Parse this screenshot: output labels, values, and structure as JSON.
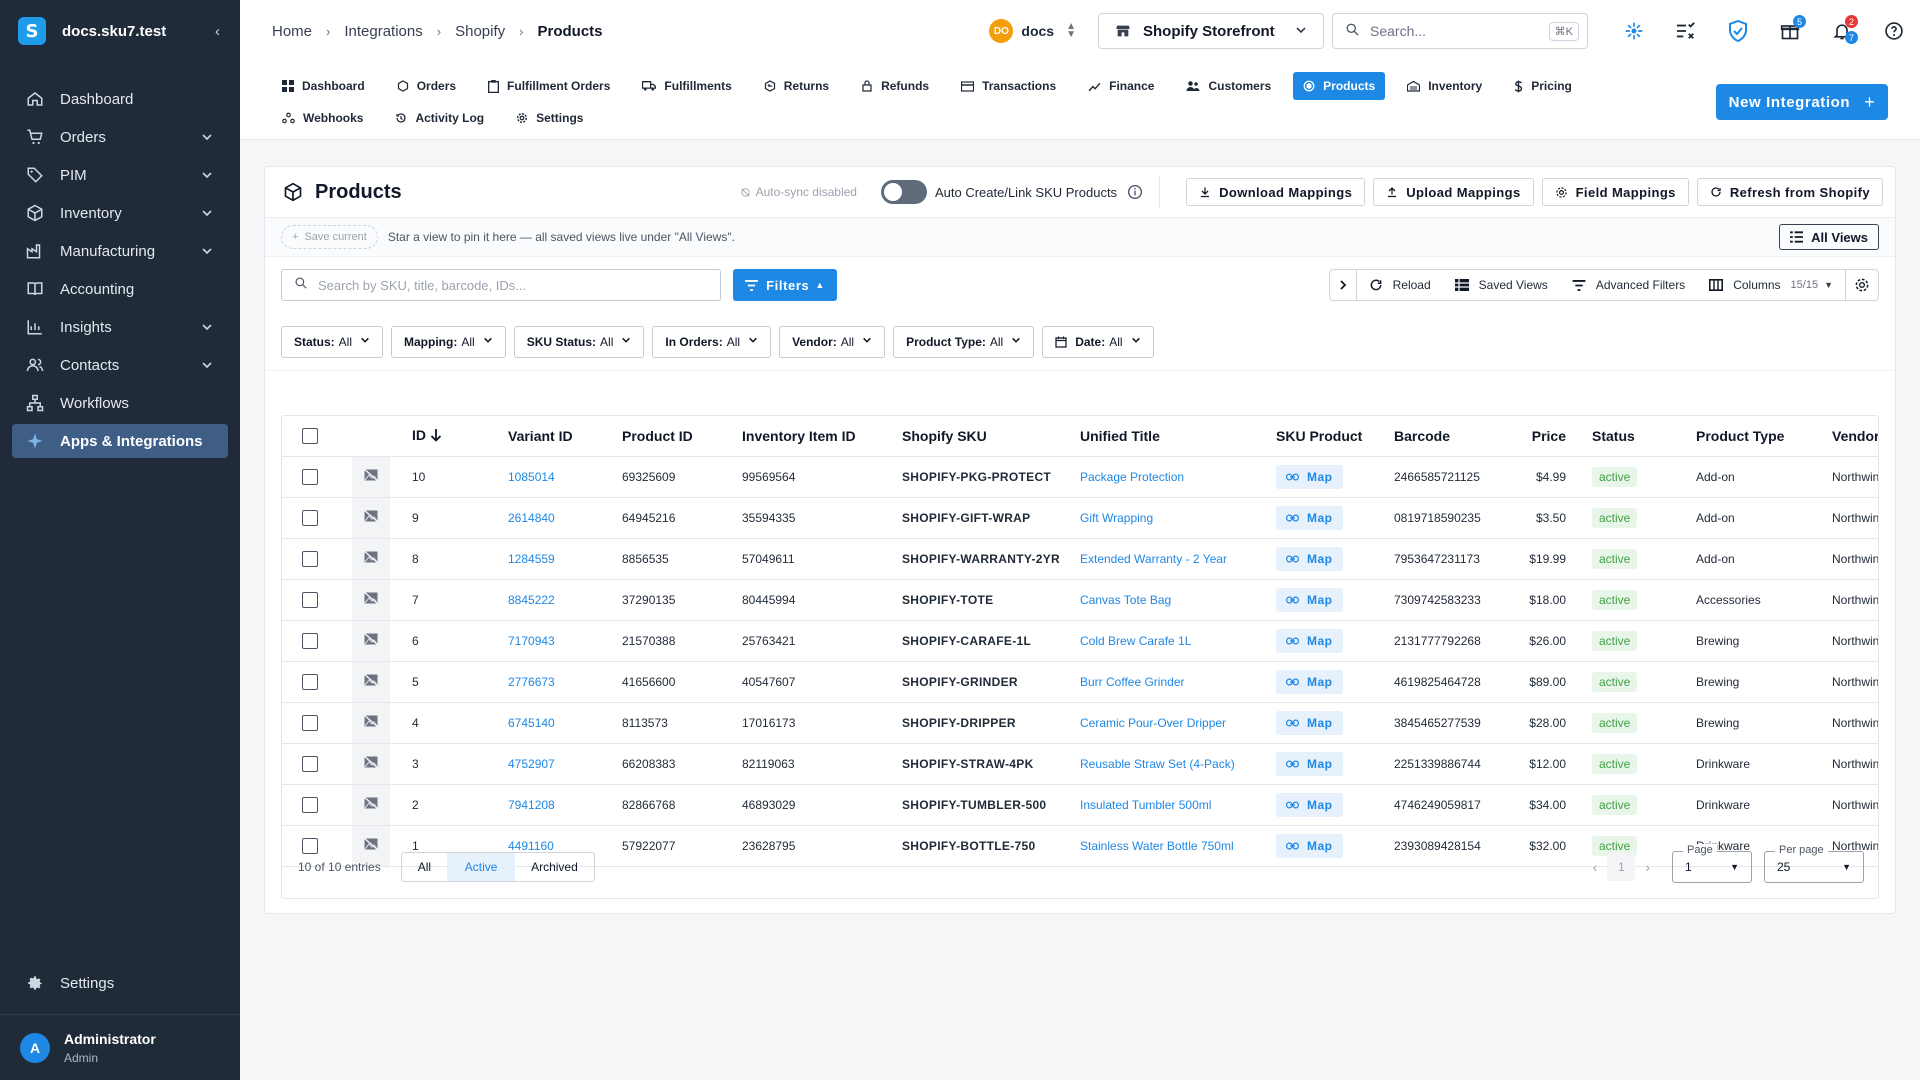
{
  "sidebar": {
    "workspace": "docs.sku7.test",
    "logo_letter": "S",
    "items": [
      {
        "label": "Dashboard",
        "icon": "home-icon",
        "chevron": false
      },
      {
        "label": "Orders",
        "icon": "cart-icon",
        "chevron": true
      },
      {
        "label": "PIM",
        "icon": "tag-icon",
        "chevron": true
      },
      {
        "label": "Inventory",
        "icon": "cube-icon",
        "chevron": true
      },
      {
        "label": "Manufacturing",
        "icon": "factory-icon",
        "chevron": true
      },
      {
        "label": "Accounting",
        "icon": "book-icon",
        "chevron": false
      },
      {
        "label": "Insights",
        "icon": "chart-icon",
        "chevron": true
      },
      {
        "label": "Contacts",
        "icon": "people-icon",
        "chevron": true
      },
      {
        "label": "Workflows",
        "icon": "workflow-icon",
        "chevron": false
      },
      {
        "label": "Apps & Integrations",
        "icon": "apps-icon",
        "chevron": false,
        "active": true
      }
    ],
    "settings_label": "Settings",
    "user": {
      "initial": "A",
      "name": "Administrator",
      "role": "Admin"
    }
  },
  "topbar": {
    "breadcrumbs": [
      "Home",
      "Integrations",
      "Shopify",
      "Products"
    ],
    "workspace_badge": "DO",
    "workspace_name": "docs",
    "store_select": "Shopify Storefront",
    "search_placeholder": "Search...",
    "search_shortcut": "⌘K",
    "gift_count": "5",
    "notif_count_a": "2",
    "notif_count_b": "7"
  },
  "subnav": {
    "tabs": [
      {
        "label": "Dashboard",
        "icon": "grid-icon"
      },
      {
        "label": "Orders",
        "icon": "box-icon"
      },
      {
        "label": "Fulfillment Orders",
        "icon": "clipboard-icon"
      },
      {
        "label": "Fulfillments",
        "icon": "truck-icon"
      },
      {
        "label": "Returns",
        "icon": "return-icon"
      },
      {
        "label": "Refunds",
        "icon": "refund-icon"
      },
      {
        "label": "Transactions",
        "icon": "card-icon"
      },
      {
        "label": "Finance",
        "icon": "finance-icon"
      },
      {
        "label": "Customers",
        "icon": "customers-icon"
      },
      {
        "label": "Products",
        "icon": "product-icon",
        "active": true
      },
      {
        "label": "Inventory",
        "icon": "warehouse-icon"
      },
      {
        "label": "Pricing",
        "icon": "dollar-icon"
      },
      {
        "label": "Webhooks",
        "icon": "webhook-icon"
      },
      {
        "label": "Activity Log",
        "icon": "history-icon"
      },
      {
        "label": "Settings",
        "icon": "gear-icon"
      }
    ],
    "new_integration": "New Integration"
  },
  "card": {
    "title": "Products",
    "autosync": "Auto-sync disabled",
    "toggle_label": "Auto Create/Link SKU Products",
    "buttons": {
      "download": "Download Mappings",
      "upload": "Upload Mappings",
      "field": "Field Mappings",
      "refresh": "Refresh from Shopify"
    },
    "save_current": "Save current",
    "views_hint": "Star a view to pin it here — all saved views live under \"All Views\".",
    "all_views": "All Views",
    "search_placeholder": "Search by SKU, title, barcode, IDs...",
    "filters": "Filters",
    "tools": {
      "reload": "Reload",
      "saved_views": "Saved Views",
      "advanced_filters": "Advanced Filters",
      "columns": "Columns",
      "columns_count": "15/15"
    },
    "chips": [
      {
        "key": "Status:",
        "val": "All"
      },
      {
        "key": "Mapping:",
        "val": "All"
      },
      {
        "key": "SKU Status:",
        "val": "All"
      },
      {
        "key": "In Orders:",
        "val": "All"
      },
      {
        "key": "Vendor:",
        "val": "All"
      },
      {
        "key": "Product Type:",
        "val": "All"
      },
      {
        "key": "Date:",
        "val": "All"
      }
    ]
  },
  "table": {
    "headers": {
      "id": "ID",
      "variant": "Variant ID",
      "product": "Product ID",
      "inv": "Inventory Item ID",
      "sku": "Shopify SKU",
      "title": "Unified Title",
      "skuprod": "SKU Product",
      "barcode": "Barcode",
      "price": "Price",
      "status": "Status",
      "ptype": "Product Type",
      "vendor": "Vendor"
    },
    "map_label": "Map",
    "rows": [
      {
        "id": "10",
        "variant": "1085014",
        "product": "69325609",
        "inv": "99569564",
        "sku": "SHOPIFY-PKG-PROTECT",
        "title": "Package Protection",
        "barcode": "2466585721125",
        "price": "$4.99",
        "status": "active",
        "ptype": "Add-on",
        "vendor": "Northwind"
      },
      {
        "id": "9",
        "variant": "2614840",
        "product": "64945216",
        "inv": "35594335",
        "sku": "SHOPIFY-GIFT-WRAP",
        "title": "Gift Wrapping",
        "barcode": "0819718590235",
        "price": "$3.50",
        "status": "active",
        "ptype": "Add-on",
        "vendor": "Northwind"
      },
      {
        "id": "8",
        "variant": "1284559",
        "product": "8856535",
        "inv": "57049611",
        "sku": "SHOPIFY-WARRANTY-2YR",
        "title": "Extended Warranty - 2 Year",
        "barcode": "7953647231173",
        "price": "$19.99",
        "status": "active",
        "ptype": "Add-on",
        "vendor": "Northwind"
      },
      {
        "id": "7",
        "variant": "8845222",
        "product": "37290135",
        "inv": "80445994",
        "sku": "SHOPIFY-TOTE",
        "title": "Canvas Tote Bag",
        "barcode": "7309742583233",
        "price": "$18.00",
        "status": "active",
        "ptype": "Accessories",
        "vendor": "Northwind"
      },
      {
        "id": "6",
        "variant": "7170943",
        "product": "21570388",
        "inv": "25763421",
        "sku": "SHOPIFY-CARAFE-1L",
        "title": "Cold Brew Carafe 1L",
        "barcode": "2131777792268",
        "price": "$26.00",
        "status": "active",
        "ptype": "Brewing",
        "vendor": "Northwind"
      },
      {
        "id": "5",
        "variant": "2776673",
        "product": "41656600",
        "inv": "40547607",
        "sku": "SHOPIFY-GRINDER",
        "title": "Burr Coffee Grinder",
        "barcode": "4619825464728",
        "price": "$89.00",
        "status": "active",
        "ptype": "Brewing",
        "vendor": "Northwind"
      },
      {
        "id": "4",
        "variant": "6745140",
        "product": "8113573",
        "inv": "17016173",
        "sku": "SHOPIFY-DRIPPER",
        "title": "Ceramic Pour-Over Dripper",
        "barcode": "3845465277539",
        "price": "$28.00",
        "status": "active",
        "ptype": "Brewing",
        "vendor": "Northwind"
      },
      {
        "id": "3",
        "variant": "4752907",
        "product": "66208383",
        "inv": "82119063",
        "sku": "SHOPIFY-STRAW-4PK",
        "title": "Reusable Straw Set (4-Pack)",
        "barcode": "2251339886744",
        "price": "$12.00",
        "status": "active",
        "ptype": "Drinkware",
        "vendor": "Northwind"
      },
      {
        "id": "2",
        "variant": "7941208",
        "product": "82866768",
        "inv": "46893029",
        "sku": "SHOPIFY-TUMBLER-500",
        "title": "Insulated Tumbler 500ml",
        "barcode": "4746249059817",
        "price": "$34.00",
        "status": "active",
        "ptype": "Drinkware",
        "vendor": "Northwind"
      },
      {
        "id": "1",
        "variant": "4491160",
        "product": "57922077",
        "inv": "23628795",
        "sku": "SHOPIFY-BOTTLE-750",
        "title": "Stainless Water Bottle 750ml",
        "barcode": "2393089428154",
        "price": "$32.00",
        "status": "active",
        "ptype": "Drinkware",
        "vendor": "Northwind"
      }
    ],
    "footer": {
      "entries": "10 of 10 entries",
      "segments": [
        "All",
        "Active",
        "Archived"
      ],
      "active_segment": "Active",
      "page_label": "Page",
      "page_value": "1",
      "current_page": "1",
      "per_page_label": "Per page",
      "per_page_value": "25"
    }
  },
  "colors": {
    "accent": "#1e88e5",
    "sidebar": "#1f2b38",
    "active_status": "#43a047"
  }
}
